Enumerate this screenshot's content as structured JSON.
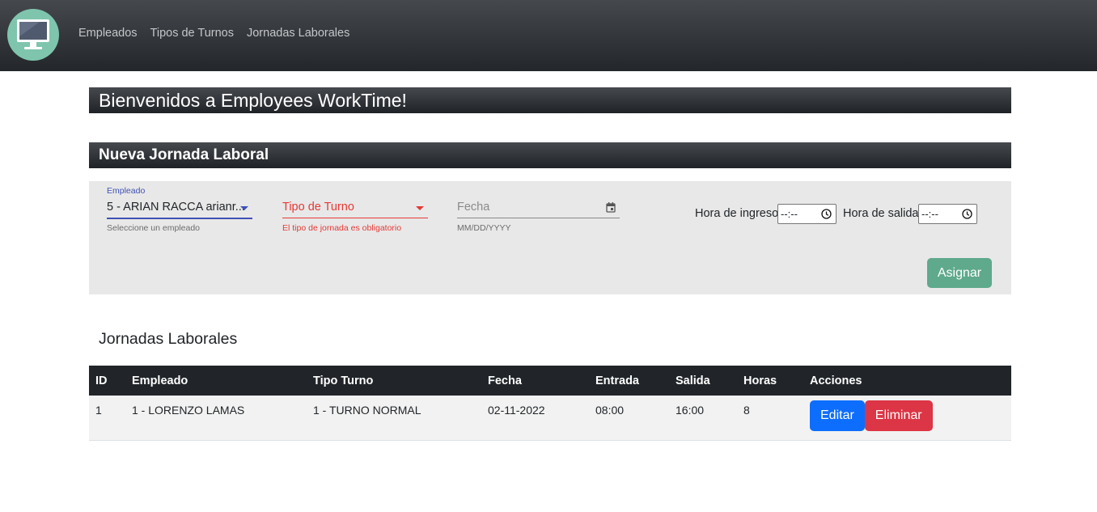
{
  "nav": {
    "links": [
      "Empleados",
      "Tipos de Turnos",
      "Jornadas Laborales"
    ]
  },
  "welcome": "Bienvenidos a Employees WorkTime!",
  "form": {
    "title": "Nueva Jornada Laboral",
    "empleado": {
      "label": "Empleado",
      "value": "5 - ARIAN RACCA arianr...",
      "hint": "Seleccione un empleado"
    },
    "tipo_turno": {
      "placeholder": "Tipo de Turno",
      "error": "El tipo de jornada es obligatorio"
    },
    "fecha": {
      "placeholder": "Fecha",
      "hint": "MM/DD/YYYY"
    },
    "hora_ingreso": {
      "label": "Hora de ingreso:",
      "value": "--:--"
    },
    "hora_salida": {
      "label": "Hora de salida:",
      "value": "--:--"
    },
    "submit_label": "Asignar"
  },
  "list": {
    "title": "Jornadas Laborales",
    "columns": [
      "ID",
      "Empleado",
      "Tipo Turno",
      "Fecha",
      "Entrada",
      "Salida",
      "Horas",
      "Acciones"
    ],
    "rows": [
      {
        "id": "1",
        "empleado": "1 - LORENZO LAMAS",
        "tipo_turno": "1 - TURNO NORMAL",
        "fecha": "02-11-2022",
        "entrada": "08:00",
        "salida": "16:00",
        "horas": "8",
        "edit_label": "Editar",
        "delete_label": "Eliminar"
      }
    ]
  },
  "colors": {
    "accent": "#3f51b5",
    "error": "#e53935",
    "success": "#5fa98c",
    "primary": "#0d6efd",
    "danger": "#dc3545"
  },
  "icons": {
    "logo": "monitor-icon",
    "calendar": "calendar-icon",
    "clock": "clock-icon"
  }
}
